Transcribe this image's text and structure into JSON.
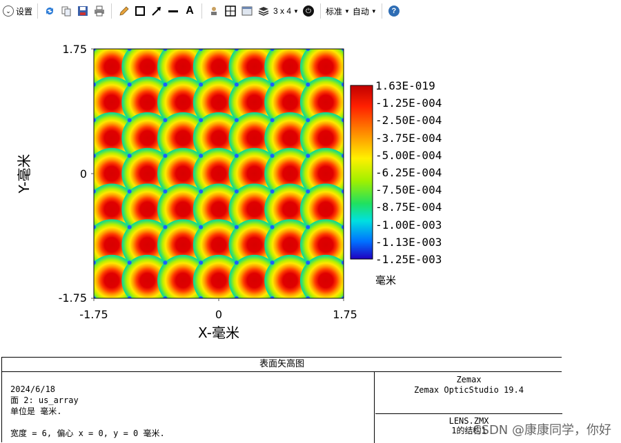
{
  "toolbar": {
    "settings_label": "设置",
    "layout_label": "3 x 4",
    "standard_label": "标准",
    "auto_label": "自动",
    "text_tool_glyph": "A",
    "help_glyph": "?"
  },
  "chart_data": {
    "type": "heatmap",
    "title": "表面矢高图",
    "xlabel": "X-毫米",
    "ylabel": "Y-毫米",
    "xlim": [
      -1.75,
      1.75
    ],
    "ylim": [
      -1.75,
      1.75
    ],
    "x_ticks": [
      "-1.75",
      "0",
      "1.75"
    ],
    "y_ticks": [
      "1.75",
      "0",
      "-1.75"
    ],
    "grid": "7x7 lenslet array",
    "colorbar": {
      "labels": [
        "1.63E-019",
        "-1.25E-004",
        "-2.50E-004",
        "-3.75E-004",
        "-5.00E-004",
        "-6.25E-004",
        "-7.50E-004",
        "-8.75E-004",
        "-1.00E-003",
        "-1.13E-003",
        "-1.25E-003"
      ],
      "max": 1.63e-19,
      "min": -0.00125,
      "unit": "毫米"
    }
  },
  "info": {
    "title": "表面矢高图",
    "date": "2024/6/18",
    "surface": "面 2: us_array",
    "units": "单位是 毫米.",
    "width_line": "宽度 = 6, 偏心 x = 0, y = 0 毫米.",
    "company": "Zemax",
    "product": "Zemax OpticStudio 19.4",
    "file": "LENS.ZMX",
    "config": "1的结构1"
  },
  "watermark": "CSDN @康康同学，你好"
}
